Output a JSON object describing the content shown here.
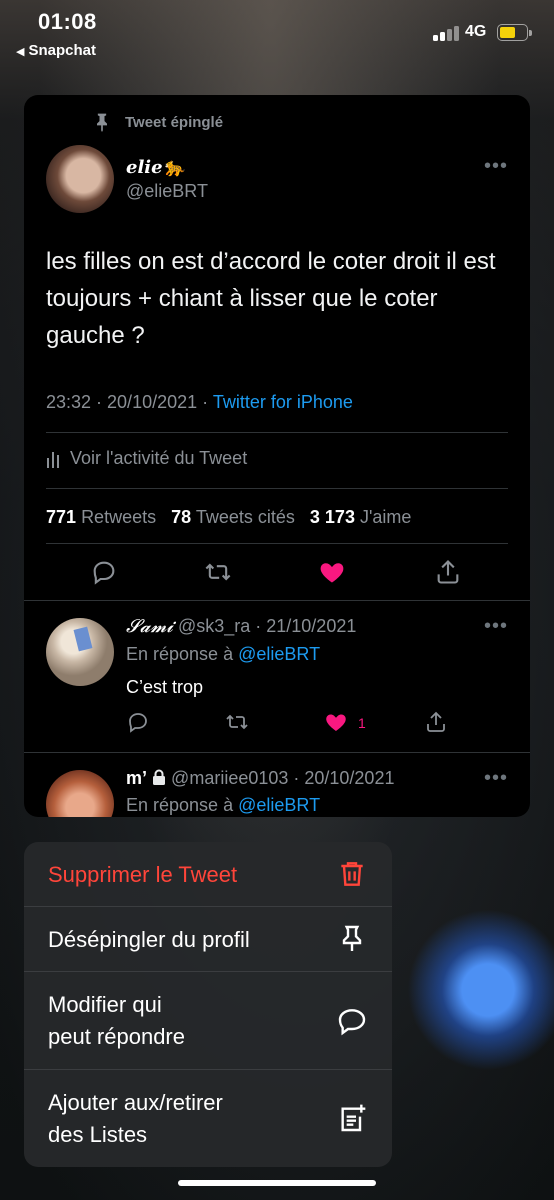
{
  "status_bar": {
    "time": "01:08",
    "back_app": "Snapchat",
    "network": "4G",
    "battery_color": "#f5d20a"
  },
  "tweet": {
    "pinned_label": "Tweet épinglé",
    "author_name": "elie🐆",
    "author_handle": "@elieBRT",
    "text": "les filles on est d’accord le coter droit il est toujours + chiant à lisser que le coter gauche ?",
    "time": "23:32 · 20/10/2021 · ",
    "source": "Twitter for iPhone",
    "activity_label": "Voir l'activité du Tweet",
    "retweets_count": "771",
    "retweets_label": "Retweets",
    "quotes_count": "78",
    "quotes_label": "Tweets cités",
    "likes_count": "3 173",
    "likes_label": "J'aime",
    "liked": true
  },
  "replies": [
    {
      "name": "𝓢𝓪𝓶𝓲",
      "handle_date": "@sk3_ra · 21/10/2021",
      "in_reply_prefix": "En réponse à",
      "in_reply_to": "@elieBRT",
      "text": "C’est trop",
      "like_count": "1"
    },
    {
      "name": "m’",
      "handle_date": "@mariiee0103 · 20/10/2021",
      "in_reply_prefix": "En réponse à",
      "in_reply_to": "@elieBRT"
    }
  ],
  "menu": {
    "items": [
      {
        "label": "Supprimer le Tweet",
        "icon": "trash-icon",
        "destructive": true
      },
      {
        "label": "Désépingler du profil",
        "icon": "unpin-icon"
      },
      {
        "label_line1": "Modifier qui",
        "label_line2": "peut répondre",
        "icon": "speech-bubble-icon"
      },
      {
        "label_line1": "Ajouter aux/retirer",
        "label_line2": "des Listes",
        "icon": "add-to-list-icon"
      }
    ]
  },
  "colors": {
    "accent": "#1d9bf0",
    "like": "#f91880",
    "destructive": "#ff453a"
  }
}
